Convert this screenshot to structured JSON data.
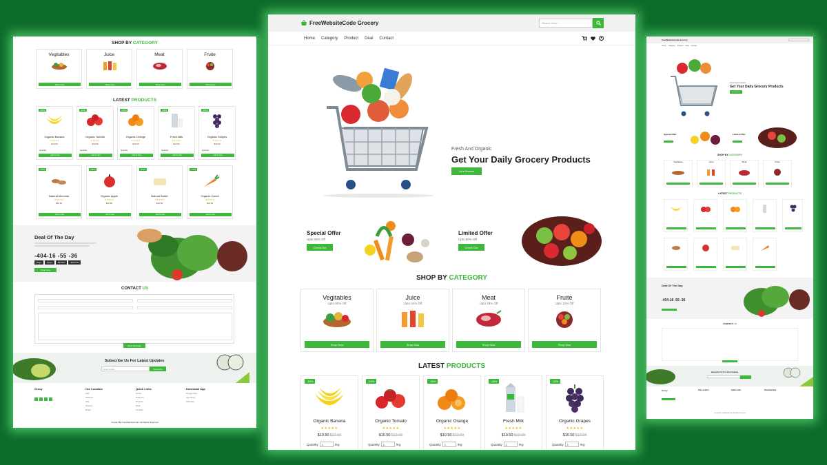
{
  "colors": {
    "page_bg": "#0d6b2b",
    "accent": "#3db83a",
    "star": "#f2b01e",
    "glow": "#78ff8c"
  },
  "header": {
    "logo_text": "FreeWebsiteCode Grocery",
    "logo_icon": "basket-icon",
    "search_placeholder": "Search Here...",
    "search_icon": "search-icon"
  },
  "nav": {
    "items": [
      "Home",
      "Category",
      "Product",
      "Deal",
      "Contact"
    ],
    "icons": [
      "cart-icon",
      "heart-icon",
      "user-icon"
    ]
  },
  "hero": {
    "subtitle": "Fresh And Organic",
    "title": "Get Your Daily Grocery Products",
    "button": "Let's Browse"
  },
  "offers": [
    {
      "title": "Special Offer",
      "subtitle": "Upto 45% Off",
      "button": "Check Out"
    },
    {
      "title": "Limited Offer",
      "subtitle": "Upto 50% Off",
      "button": "Check Out"
    }
  ],
  "shop_by_category": {
    "title_prefix": "SHOP BY ",
    "title_accent": "CATEGORY",
    "categories": [
      {
        "name": "Vegitables",
        "subtitle": "Upto 80% Off",
        "button": "Shop Now"
      },
      {
        "name": "Juice",
        "subtitle": "Upto 44% Off",
        "button": "Shop Now"
      },
      {
        "name": "Meat",
        "subtitle": "Upto 28% Off",
        "button": "Shop Now"
      },
      {
        "name": "Fruite",
        "subtitle": "Upto 12% Off",
        "button": "Shop Now"
      }
    ]
  },
  "latest_products": {
    "title_prefix": "LATEST ",
    "title_accent": "PRODUCTS",
    "products": [
      {
        "name": "Organic Banana",
        "badge": "-15%",
        "stars": "★★★★★",
        "price": "$10.50",
        "old_price": "$12.00",
        "qty_label": "Quantity",
        "qty": "1",
        "unit": "/Kg"
      },
      {
        "name": "Organic Tomato",
        "badge": "-15%",
        "stars": "★★★★★",
        "price": "$10.50",
        "old_price": "$12.00",
        "qty_label": "Quantity",
        "qty": "1",
        "unit": "/Kg"
      },
      {
        "name": "Organic Orange",
        "badge": "-15%",
        "stars": "★★★★★",
        "price": "$10.50",
        "old_price": "$12.00",
        "qty_label": "Quantity",
        "qty": "1",
        "unit": "/Kg"
      },
      {
        "name": "Fresh Milk",
        "badge": "-15%",
        "stars": "★★★★★",
        "price": "$10.50",
        "old_price": "$12.00",
        "qty_label": "Quantity",
        "qty": "1",
        "unit": "/Kg"
      },
      {
        "name": "Organic Grapes",
        "badge": "-15%",
        "stars": "★★★★★",
        "price": "$10.50",
        "old_price": "$12.00",
        "qty_label": "Quantity",
        "qty": "1",
        "unit": "/Kg"
      },
      {
        "name": "Natural Almonds",
        "badge": "-15%",
        "stars": "★★★★★",
        "price": "$10.50",
        "old_price": "$12.00",
        "qty_label": "Quantity",
        "qty": "1",
        "unit": "/Kg"
      },
      {
        "name": "Organic Apple",
        "badge": "-15%",
        "stars": "★★★★★",
        "price": "$10.50",
        "old_price": "$12.00",
        "qty_label": "Quantity",
        "qty": "1",
        "unit": "/Kg"
      },
      {
        "name": "Natural Butter",
        "badge": "-15%",
        "stars": "★★★★★",
        "price": "$10.50",
        "old_price": "$12.00",
        "qty_label": "Quantity",
        "qty": "1",
        "unit": "/Kg"
      },
      {
        "name": "Organic Carrot",
        "badge": "-15%",
        "stars": "★★★★★",
        "price": "$10.50",
        "old_price": "$12.00",
        "qty_label": "Quantity",
        "qty": "1",
        "unit": "/Kg"
      }
    ],
    "button": "Add To Cart"
  },
  "deal": {
    "title": "Deal Of The Day",
    "timer": "-404-16 -55 -36",
    "timer_labels": [
      "Days",
      "Hours",
      "Minutes",
      "Seconds"
    ],
    "button": "Shop Now"
  },
  "contact": {
    "title_prefix": "CONTACT ",
    "title_accent": "US",
    "button": "Send Message"
  },
  "subscribe": {
    "title": "Subscribe Us For Latest Updates",
    "placeholder": "Enter Email...",
    "button": "Subscribe"
  },
  "footer": {
    "brand": "Grocy",
    "columns": [
      {
        "title": "Our Location",
        "items": [
          "Add",
          "Address",
          "City",
          "Country",
          "Email"
        ]
      },
      {
        "title": "Quick Links",
        "items": [
          "Home",
          "Category",
          "Product",
          "Deal",
          "Contact"
        ]
      },
      {
        "title": "Download App",
        "items": [
          "Google Play",
          "App Store",
          "Windows"
        ]
      }
    ],
    "copyright": "Created By FreeWebsiteCode | All Rights Reserved"
  }
}
